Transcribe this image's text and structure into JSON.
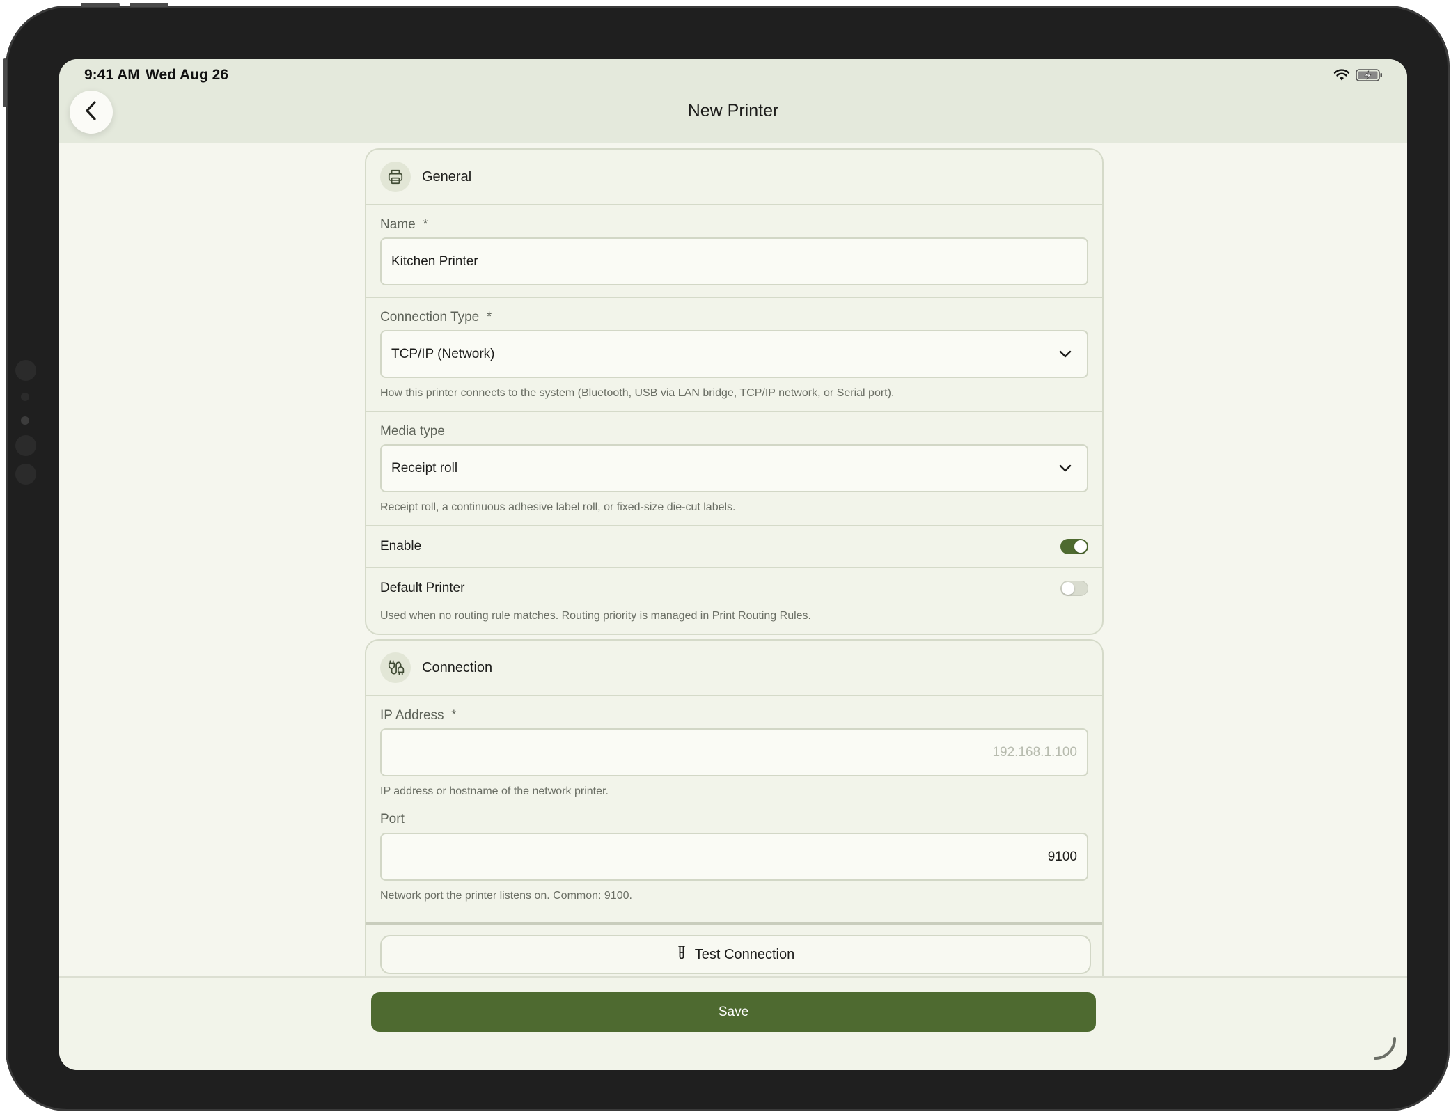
{
  "status_bar": {
    "time": "9:41 AM",
    "date": "Wed Aug 26",
    "icons": [
      "wifi-icon",
      "battery-charging-icon"
    ]
  },
  "nav": {
    "title": "New Printer",
    "back_icon": "chevron-left-icon"
  },
  "general": {
    "title": "General",
    "icon": "printer-icon",
    "name_label": "Name",
    "name_value": "Kitchen Printer",
    "connection_type_label": "Connection Type",
    "connection_type_value": "TCP/IP (Network)",
    "connection_type_help": "How this printer connects to the system (Bluetooth, USB via LAN bridge, TCP/IP network, or Serial port).",
    "media_type_label": "Media type",
    "media_type_value": "Receipt roll",
    "media_type_help": "Receipt roll, a continuous adhesive label roll, or fixed-size die-cut labels.",
    "enable_label": "Enable",
    "enable_on": true,
    "default_label": "Default Printer",
    "default_on": false,
    "default_help": "Used when no routing rule matches. Routing priority is managed in Print Routing Rules.",
    "required_mark": "*"
  },
  "connection": {
    "title": "Connection",
    "icon": "plug-cable-icon",
    "ip_label": "IP Address",
    "ip_value": "",
    "ip_placeholder": "192.168.1.100",
    "ip_help": "IP address or hostname of the network printer.",
    "port_label": "Port",
    "port_value": "9100",
    "port_help": "Network port the printer listens on. Common: 9100.",
    "test_label": "Test Connection",
    "test_icon": "test-tube-icon"
  },
  "footer": {
    "save_label": "Save"
  },
  "colors": {
    "accent": "#4e6a30",
    "background": "#f5f6ee",
    "header": "#e4e9dc"
  }
}
